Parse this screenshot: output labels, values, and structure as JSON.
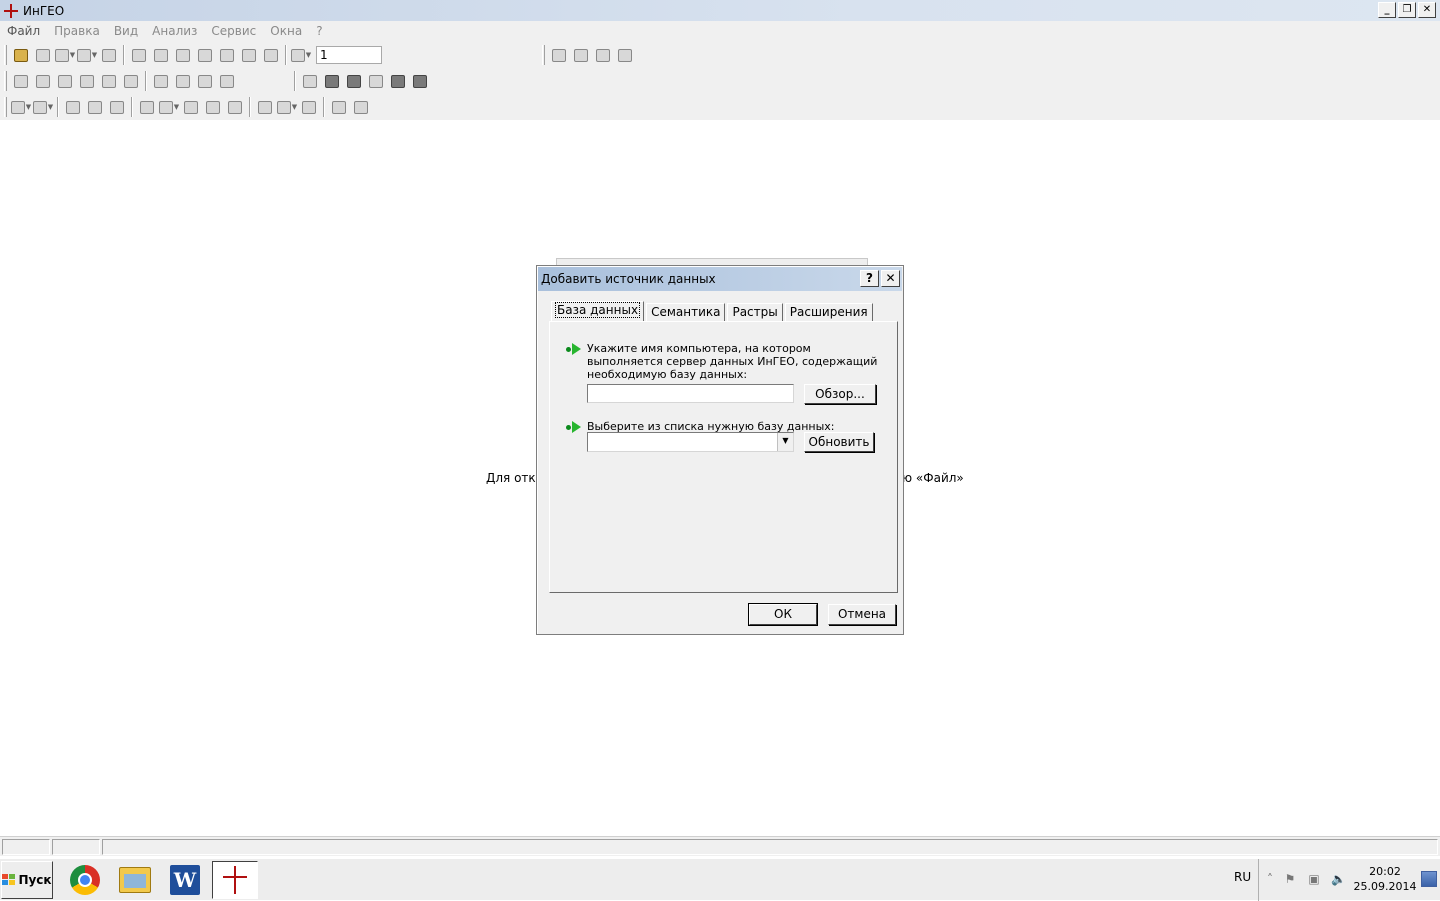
{
  "app": {
    "title": "ИнГЕО"
  },
  "menu": [
    "Файл",
    "Правка",
    "Вид",
    "Анализ",
    "Сервис",
    "Окна",
    "?"
  ],
  "toolbar": {
    "scale_value": "1"
  },
  "workspace": {
    "hint_left": "Для откры",
    "hint_right": "ю «Файл»"
  },
  "dialog": {
    "title": "Добавить источник данных",
    "help_button": "?",
    "close_button": "✕",
    "tabs": [
      "База данных",
      "Семантика",
      "Растры",
      "Расширения"
    ],
    "active_tab": "База данных",
    "server_label": "Укажите имя компьютера, на котором выполняется сервер данных ИнГЕО, содержащий необходимую базу данных:",
    "server_value": "",
    "browse_button": "Обзор...",
    "db_label": "Выберите из списка нужную базу данных:",
    "db_value": "",
    "refresh_button": "Обновить",
    "ok_button": "ОК",
    "cancel_button": "Отмена"
  },
  "taskbar": {
    "start_label": "Пуск",
    "apps": [
      "chrome-icon",
      "explorer-icon",
      "word-icon",
      "ingeo-icon"
    ],
    "language": "RU",
    "time": "20:02",
    "date": "25.09.2014"
  }
}
